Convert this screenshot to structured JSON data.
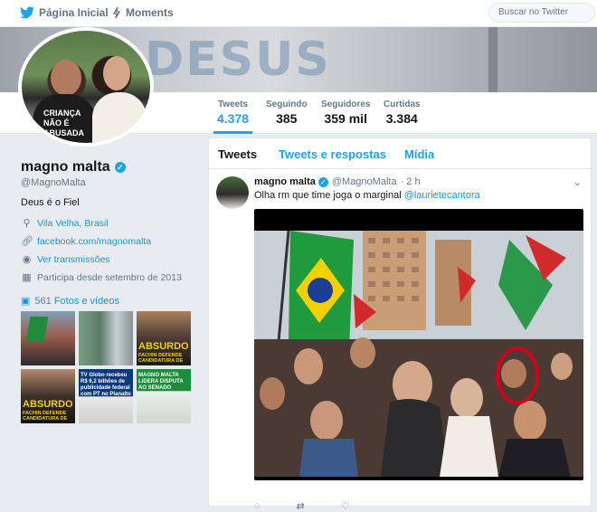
{
  "nav": {
    "home_label": "Página Inicial",
    "moments_label": "Moments",
    "search_placeholder": "Buscar no Twitter"
  },
  "banner": {
    "text": "DESUS"
  },
  "stats": [
    {
      "label": "Tweets",
      "value": "4.378"
    },
    {
      "label": "Seguindo",
      "value": "385"
    },
    {
      "label": "Seguidores",
      "value": "359 mil"
    },
    {
      "label": "Curtidas",
      "value": "3.384"
    }
  ],
  "avatar_print": "CRIANÇA\nNÃO É\nABUSADA",
  "profile": {
    "name": "magno malta",
    "handle": "@MagnoMalta",
    "bio": "Deus é o Fiel",
    "location": "Vila Velha, Brasil",
    "website": "facebook.com/magnomalta",
    "broadcasts": "Ver transmissões",
    "joined": "Participa desde setembro de 2013",
    "photos_label": "561 Fotos e vídeos"
  },
  "thumbs": {
    "t3": "ABSURDO",
    "t3b": "FACHIN DEFENDE CANDIDATURA DE",
    "t4": "ABSURDO",
    "t4b": "FACHIN DEFENDE CANDIDATURA DE",
    "t5": "TV Globo recebeu R$ 6,2 bilhões de publicidade federal com PT no Planalto",
    "t6": "MAGNO MALTA LIDERA DISPUTA AO SENADO"
  },
  "timeline": {
    "tabs": [
      "Tweets",
      "Tweets e respostas",
      "Mídia"
    ],
    "tweet": {
      "name": "magno malta",
      "handle": "@MagnoMalta",
      "time": "· 2 h",
      "text": "Olha rm que time joga o marginal",
      "mention": "@laurietecantora"
    }
  },
  "colors": {
    "accent": "#1da1f2",
    "link": "#1b95e0",
    "background": "#e6ecf0",
    "highlight_circle": "#d0021b"
  }
}
